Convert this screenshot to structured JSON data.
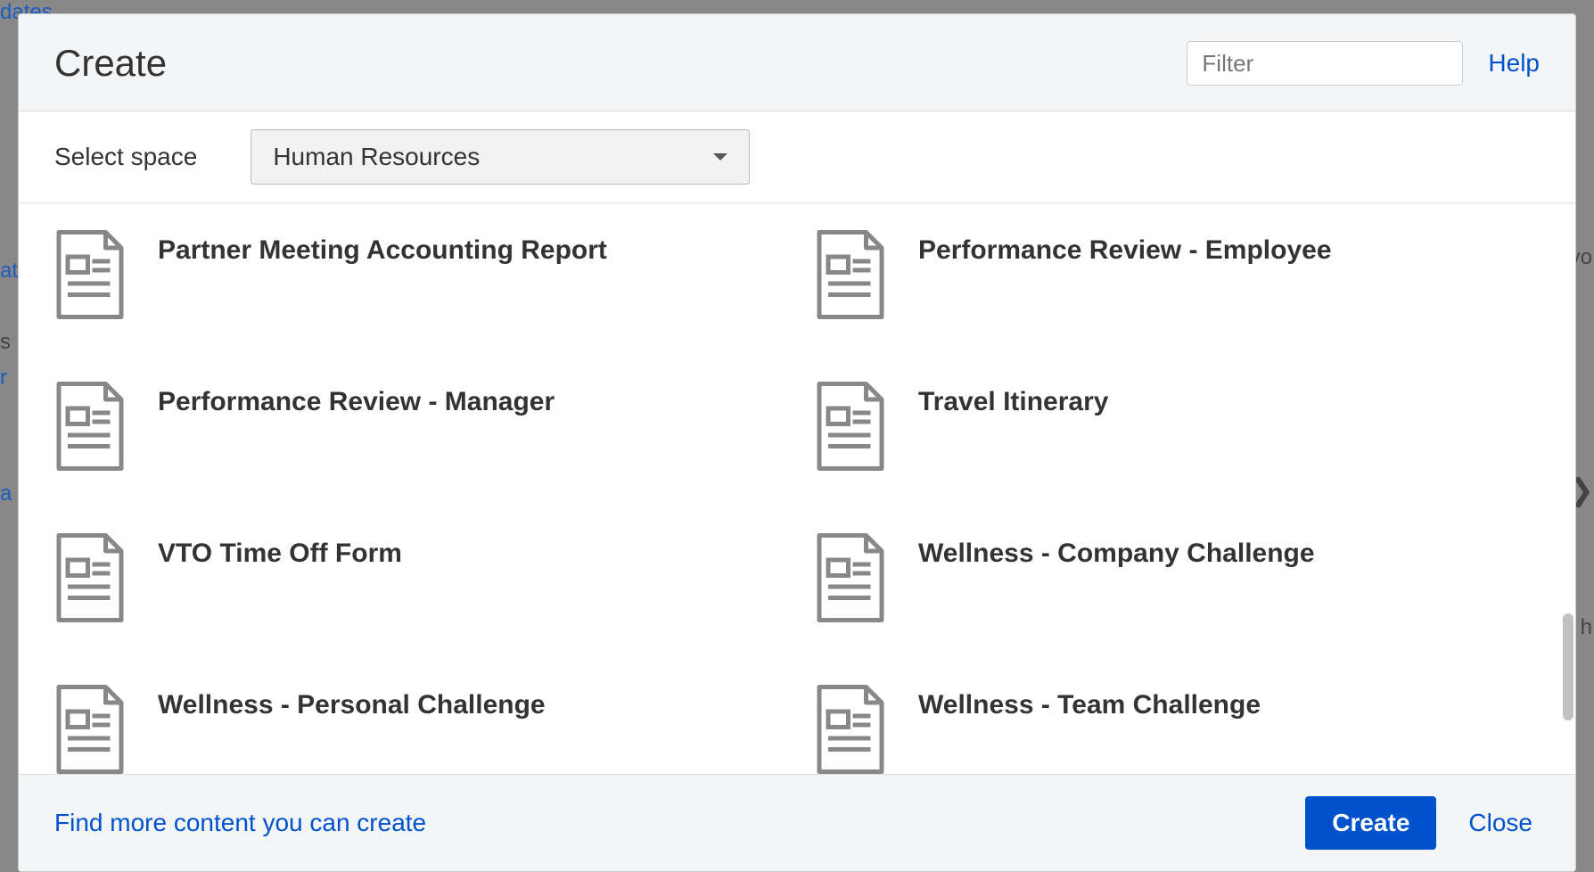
{
  "header": {
    "title": "Create",
    "filter_placeholder": "Filter",
    "help_label": "Help"
  },
  "space": {
    "label": "Select space",
    "selected": "Human Resources"
  },
  "templates": [
    {
      "title": "Partner Meeting Accounting Report"
    },
    {
      "title": "Performance Review - Employee"
    },
    {
      "title": "Performance Review - Manager"
    },
    {
      "title": "Travel Itinerary"
    },
    {
      "title": "VTO Time Off Form"
    },
    {
      "title": "Wellness - Company Challenge"
    },
    {
      "title": "Wellness - Personal Challenge"
    },
    {
      "title": "Wellness - Team Challenge"
    }
  ],
  "footer": {
    "find_more_label": "Find more content you can create",
    "create_label": "Create",
    "close_label": "Close"
  },
  "backdrop_hints": {
    "dates": "dates",
    "at1": "at",
    "s": "s",
    "r": "r",
    "a": "a",
    "vo": "vo",
    "h": "h",
    "arrow": "❯"
  }
}
